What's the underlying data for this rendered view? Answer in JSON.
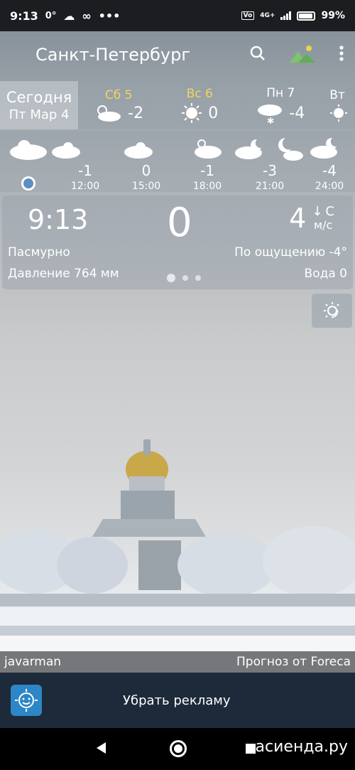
{
  "status_bar": {
    "time": "9:13",
    "temp": "0°",
    "dots": "•••",
    "battery": "99%",
    "network": "4G+"
  },
  "app_bar": {
    "city": "Санкт-Петербург",
    "search_icon": "search-icon",
    "wallpaper_icon": "landscape-icon",
    "menu_icon": "more-vert-icon"
  },
  "days": [
    {
      "line1": "Сегодня",
      "line2": "Пт Мар 4",
      "today": true
    },
    {
      "label": "Сб 5",
      "temp": "-2",
      "icon": "partly-cloudy",
      "label_color": "#f4d35e"
    },
    {
      "label": "Вс 6",
      "temp": "0",
      "icon": "sunny",
      "label_color": "#f4d35e"
    },
    {
      "label": "Пн 7",
      "temp": "-4",
      "icon": "snow",
      "label_color": "#ffffff"
    },
    {
      "label": "Вт",
      "temp": "",
      "icon": "sunny",
      "label_color": "#ffffff"
    }
  ],
  "hourly": [
    {
      "temp": "-1",
      "hour": "12:00"
    },
    {
      "temp": "0",
      "hour": "15:00"
    },
    {
      "temp": "-1",
      "hour": "18:00"
    },
    {
      "temp": "-3",
      "hour": "21:00"
    },
    {
      "temp": "-4",
      "hour": "24:00"
    }
  ],
  "current": {
    "time": "9:13",
    "temp": "0",
    "wind_speed": "4",
    "wind_dir": "С",
    "wind_unit": "м/с",
    "condition": "Пасмурно",
    "feels_like": "По ощущению -4°",
    "pressure": "Давление 764 мм",
    "precip": "Вода 0"
  },
  "credit": {
    "author": "javarman",
    "source": "Прогноз от Foreca"
  },
  "ad": {
    "label": "Убрать рекламу"
  },
  "watermark": "асиенда.ру"
}
